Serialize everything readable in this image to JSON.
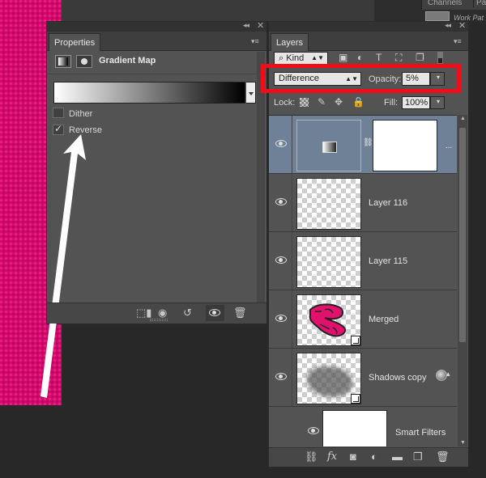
{
  "tabs_top": {
    "channels": "Channels",
    "paths": "Pat",
    "work_path": "Work Pat"
  },
  "properties": {
    "tab_label": "Properties",
    "adjustment_title": "Gradient Map",
    "dither_label": "Dither",
    "dither_checked": false,
    "reverse_label": "Reverse",
    "reverse_checked": true,
    "tick": "✓",
    "footer_icons": [
      "clip-to-layer-icon",
      "view-previous-icon",
      "reset-icon",
      "visibility-icon",
      "trash-icon"
    ]
  },
  "layers": {
    "tab_label": "Layers",
    "filter_kind": "Kind",
    "search_glyph": "⌕",
    "blend_mode": "Difference",
    "opacity_label": "Opacity:",
    "opacity_value": "5%",
    "lock_label": "Lock:",
    "fill_label": "Fill:",
    "fill_value": "100%",
    "rows": [
      {
        "name": "",
        "type": "gradient-map-adjustment",
        "selected": true
      },
      {
        "name": "Layer 116",
        "type": "pixel"
      },
      {
        "name": "Layer 115",
        "type": "pixel"
      },
      {
        "name": "Merged",
        "type": "smart-object"
      },
      {
        "name": "Shadows copy",
        "type": "smart-object"
      },
      {
        "name": "Smart Filters",
        "type": "smart-filters"
      }
    ],
    "more_glyph": "...",
    "footer_icons": [
      "link-icon",
      "fx-icon",
      "mask-icon",
      "adjustment-icon",
      "folder-icon",
      "new-layer-icon",
      "trash-icon"
    ]
  },
  "colors": {
    "canvas_pink": "#d3096e",
    "highlight_red": "#ee0d19",
    "selected_row": "#6f8197"
  }
}
